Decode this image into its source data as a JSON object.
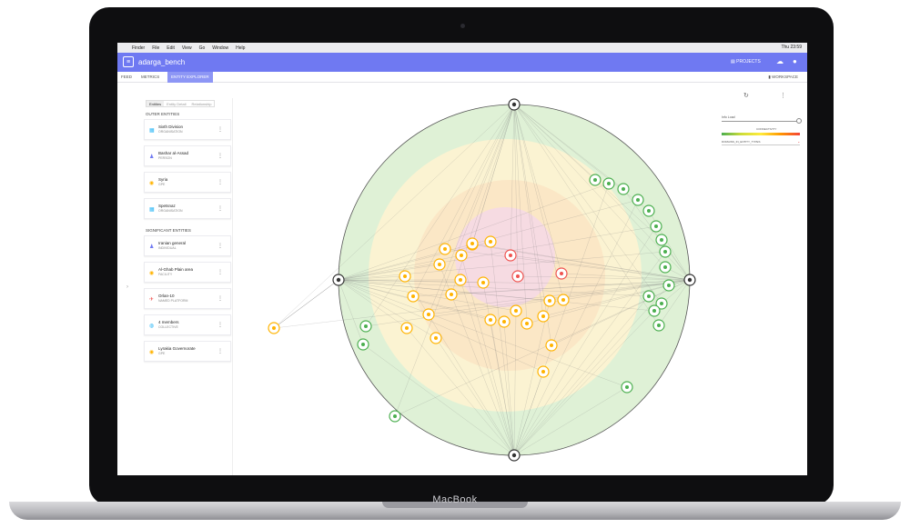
{
  "menubar": {
    "apple": "",
    "items": [
      "Finder",
      "File",
      "Edit",
      "View",
      "Go",
      "Window",
      "Help"
    ],
    "status": "Thu 23:59"
  },
  "app": {
    "name": "adarga_bench",
    "projects_label": "PROJECTS",
    "tabs": [
      "FEED",
      "METRICS",
      "ENTITY EXPLORER"
    ],
    "active_tab": "ENTITY EXPLORER",
    "workspace_label": "WORKSPACE"
  },
  "panel": {
    "subtabs": [
      "Entities",
      "Entity Detail",
      "Relationship"
    ],
    "outer_title": "OUTER ENTITIES",
    "outer_entities": [
      {
        "name": "Sixth Division",
        "type": "ORGANISATION",
        "icon": "building-icon",
        "color": "#29b6f6"
      },
      {
        "name": "Bashar al-Assad",
        "type": "PERSON",
        "icon": "person-icon",
        "color": "#6f79f2"
      },
      {
        "name": "Syria",
        "type": "GPE",
        "icon": "pin-icon",
        "color": "#ffb300"
      },
      {
        "name": "Spetsnaz",
        "type": "ORGANISATION",
        "icon": "building-icon",
        "color": "#29b6f6"
      }
    ],
    "significant_title": "SIGNIFICANT ENTITIES",
    "significant_entities": [
      {
        "name": "Iranian general",
        "type": "INDIVIDUAL",
        "icon": "person-icon",
        "color": "#6f79f2"
      },
      {
        "name": "Al-Ghab Plain area",
        "type": "FACILITY",
        "icon": "pin-icon",
        "color": "#ffb300"
      },
      {
        "name": "Orlan-10",
        "type": "NAMED PLATFORM",
        "icon": "plane-icon",
        "color": "#ef5350"
      },
      {
        "name": "4 members",
        "type": "COLLECTIVE",
        "icon": "group-icon",
        "color": "#29b6f6"
      },
      {
        "name": "Lyrakia Governorate",
        "type": "GPE",
        "icon": "pin-icon",
        "color": "#ffb300"
      }
    ]
  },
  "controls": {
    "refresh_icon": "refresh-icon",
    "menu_icon": "kebab-icon",
    "label_load": "Info Load",
    "label_connectivity": "CONNECTIVITY",
    "select_value": "DOMAINS_IN_ENTITY_TYPES"
  },
  "colors": {
    "accent": "#6f79f2",
    "ring_outer": "#dff1d6",
    "ring_mid": "#fbf3d2",
    "ring_inner": "#fbe7c6",
    "core": "#f6dbe2"
  }
}
